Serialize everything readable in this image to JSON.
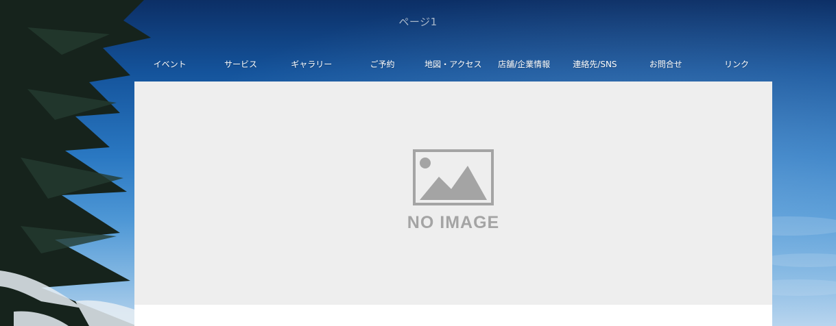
{
  "header": {
    "site_title": "ページ1"
  },
  "nav": {
    "items": [
      {
        "label": "イベント"
      },
      {
        "label": "サービス"
      },
      {
        "label": "ギャラリー"
      },
      {
        "label": "ご予約"
      },
      {
        "label": "地図・アクセス"
      },
      {
        "label": "店舗/企業情報"
      },
      {
        "label": "連絡先/SNS"
      },
      {
        "label": "お問合せ"
      },
      {
        "label": "リンク"
      }
    ]
  },
  "hero": {
    "placeholder_text": "NO IMAGE",
    "placeholder_icon": "image-placeholder-icon"
  },
  "colors": {
    "sky_top": "#0c2f66",
    "sky_bottom": "#b7d4ee",
    "nav_text": "#ffffff",
    "title_text": "#a8b7c9",
    "placeholder_bg": "#eeeeee",
    "placeholder_fg": "#a4a4a4"
  }
}
